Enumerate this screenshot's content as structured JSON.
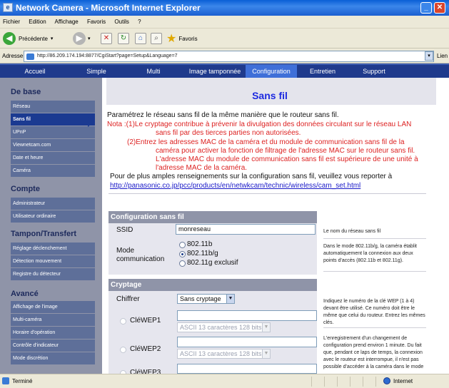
{
  "window": {
    "title": "Network Camera - Microsoft Internet Explorer",
    "app_icon": "ie-page-icon"
  },
  "menu": [
    "Fichier",
    "Edition",
    "Affichage",
    "Favoris",
    "Outils",
    "?"
  ],
  "toolbar": {
    "back": "Précédente",
    "favorites": "Favoris"
  },
  "address": {
    "label": "Adresse",
    "url": "http://86.209.174.194:8877/CgiStart?page=Setup&Language=7",
    "links": "Lien"
  },
  "nav": {
    "tabs": [
      "Accueil",
      "Simple",
      "Multi",
      "Image tamponnée",
      "Configuration",
      "Entretien",
      "Support"
    ],
    "active": "Configuration"
  },
  "sidebar": {
    "sections": [
      {
        "title": "De base",
        "items": [
          "Réseau",
          "Sans fil",
          "UPnP",
          "Viewnetcam.com",
          "Date et heure",
          "Caméra"
        ]
      },
      {
        "title": "Compte",
        "items": [
          "Administrateur",
          "Utilisateur ordinaire"
        ]
      },
      {
        "title": "Tampon/Transfert",
        "items": [
          "Réglage déclenchement",
          "Détection mouvement",
          "Registre du détecteur"
        ]
      },
      {
        "title": "Avancé",
        "items": [
          "Affichage de l'image",
          "Multi-caméra",
          "Horaire d'opération",
          "Contrôle d'indicateur",
          "Mode discrétion"
        ]
      }
    ],
    "active": "Sans fil"
  },
  "main": {
    "title": "Sans fil",
    "intro": "Paramétrez le réseau sans fil de la même manière que le routeur sans fil.",
    "note1_a": "Nota :(1)Le cryptage contribue à prévenir la divulgation des données circulant sur le réseau LAN",
    "note1_b": "sans fil par des tierces parties non autorisées.",
    "note2_a": "(2)Entrez les adresses MAC de la caméra et du module de communication sans fil de la",
    "note2_b": "caméra pour activer la fonction de filtrage de l'adresse MAC sur le routeur sans fil.",
    "note2_c": "L'adresse MAC du module de communication sans fil est supérieure de une unité à",
    "note2_d": "l'adresse MAC de la caméra.",
    "more": "Pour de plus amples renseignements sur la configuration sans fil, veuillez vous reporter à",
    "link": "http://panasonic.co.jp/pcc/products/en/netwkcam/technic/wireless/cam_set.html"
  },
  "config": {
    "section": "Configuration sans fil",
    "ssid_label": "SSID",
    "ssid_value": "monreseau",
    "ssid_help": "Le nom du réseau sans fil",
    "mode_label1": "Mode",
    "mode_label2": "communication",
    "modes": [
      "802.11b",
      "802.11b/g",
      "802.11g exclusif"
    ],
    "mode_selected": "802.11b/g",
    "mode_help": "Dans le mode 802.11b/g, la caméra établit automatiquement la connexion aux deux points d'accès (802.11b et 802.11g)."
  },
  "crypt": {
    "section": "Cryptage",
    "cipher_label": "Chiffrer",
    "cipher_value": "Sans cryptage",
    "wep1": "CléWEP1",
    "wep2": "CléWEP2",
    "wep3": "CléWEP3",
    "key_type": "ASCII 13 caractères  128 bits",
    "help1": "Indiquez le numéro de la clé WEP (1 à 4) devant être utilisé. Ce numéro doit être le même que celui du routeur. Entrez les mêmes clés.",
    "help2": "L'enregistrement d'un changement de configuration prend environ 1 minute. Du fait que, pendant ce laps de temps, la connexion avec le routeur est interrompue, il n'est pas possible d'accéder à la caméra dans le mode"
  },
  "status": {
    "left": "Terminé",
    "zone": "Internet"
  },
  "colors": {
    "titlebar": "#0a5fd6",
    "nav": "#1f3a8c",
    "nav_active": "#3f6fd8",
    "sidebar": "#8f94a8",
    "sidebar_item": "#5e6f99",
    "sidebar_active": "#1b3a91",
    "title": "#1d2ae0",
    "note": "#d22222"
  }
}
